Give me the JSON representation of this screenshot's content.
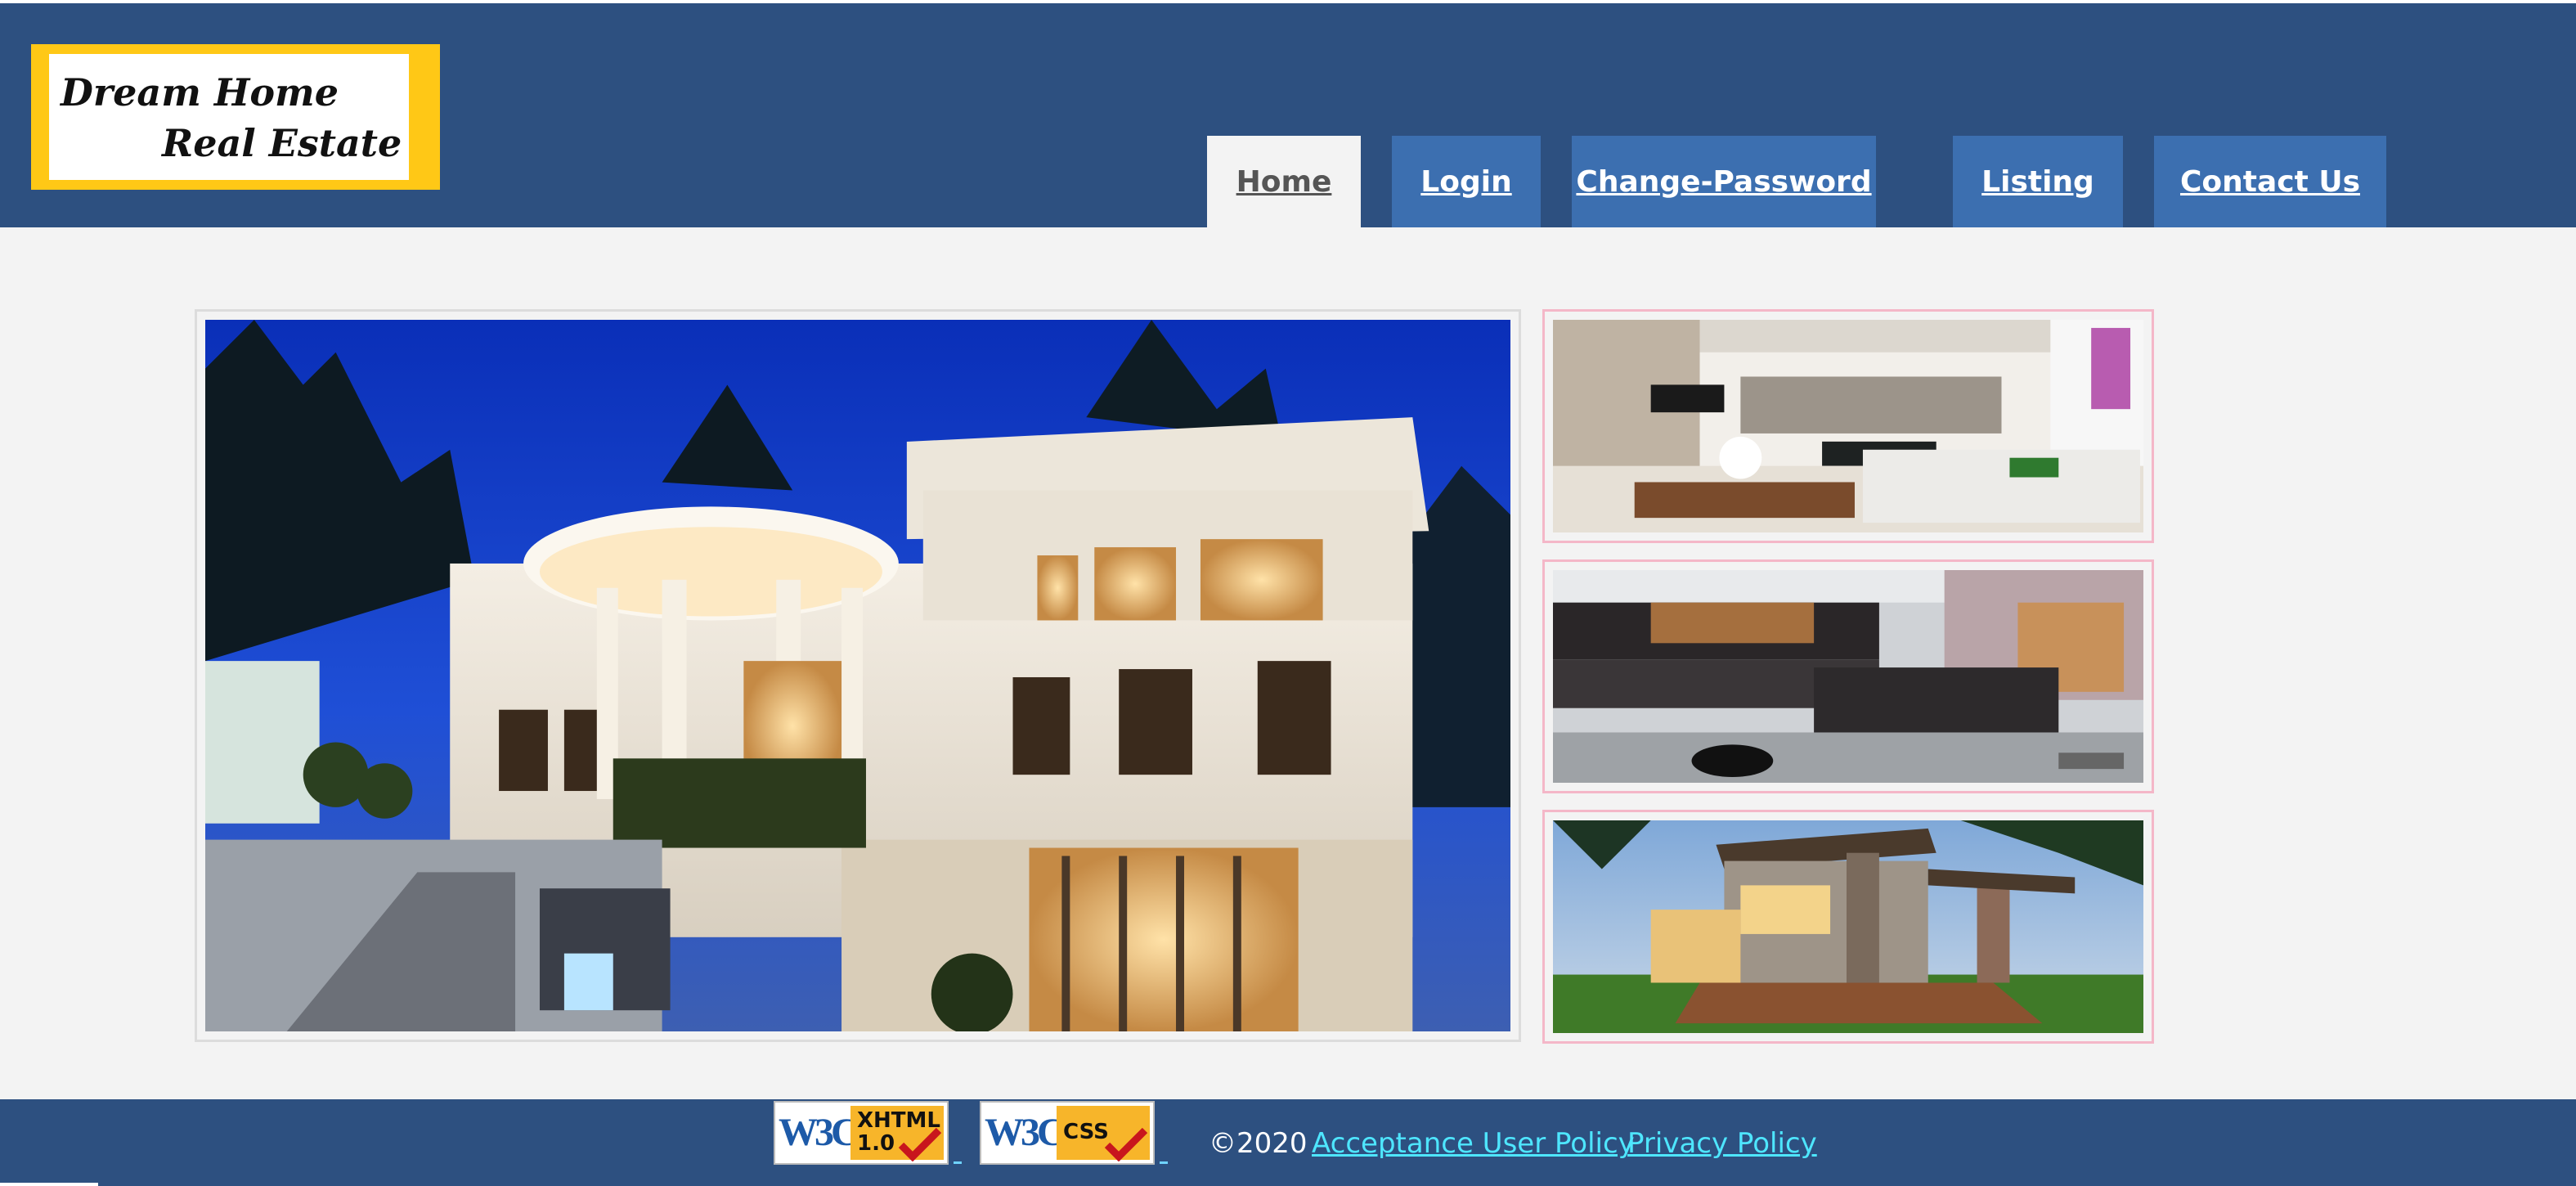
{
  "logo": {
    "line1": "Dream Home",
    "line2": "Real Estate"
  },
  "nav": {
    "items": [
      {
        "label": "Home",
        "active": true
      },
      {
        "label": "Login",
        "active": false
      },
      {
        "label": "Change-Password",
        "active": false
      },
      {
        "label": "Listing",
        "active": false
      },
      {
        "label": "Contact Us",
        "active": false
      }
    ]
  },
  "gallery": {
    "main_image": "luxury-mansion-night-photo",
    "thumbnails": [
      "living-room-interior-photo",
      "modern-kitchen-photo",
      "modern-house-deck-photo"
    ]
  },
  "footer": {
    "badges": [
      {
        "w3c": "W3C",
        "tag": "XHTML 1.0"
      },
      {
        "w3c": "W3C",
        "tag": "CSS"
      }
    ],
    "copyright": "©2020",
    "links": [
      "Acceptance User Policy",
      "Privacy Policy"
    ]
  },
  "colors": {
    "header": "#2d5080",
    "nav_tab": "#3c6fb0",
    "logo_border": "#ffc816",
    "footer_link": "#4ee6ff",
    "thumb_border": "#f4b7c8"
  }
}
